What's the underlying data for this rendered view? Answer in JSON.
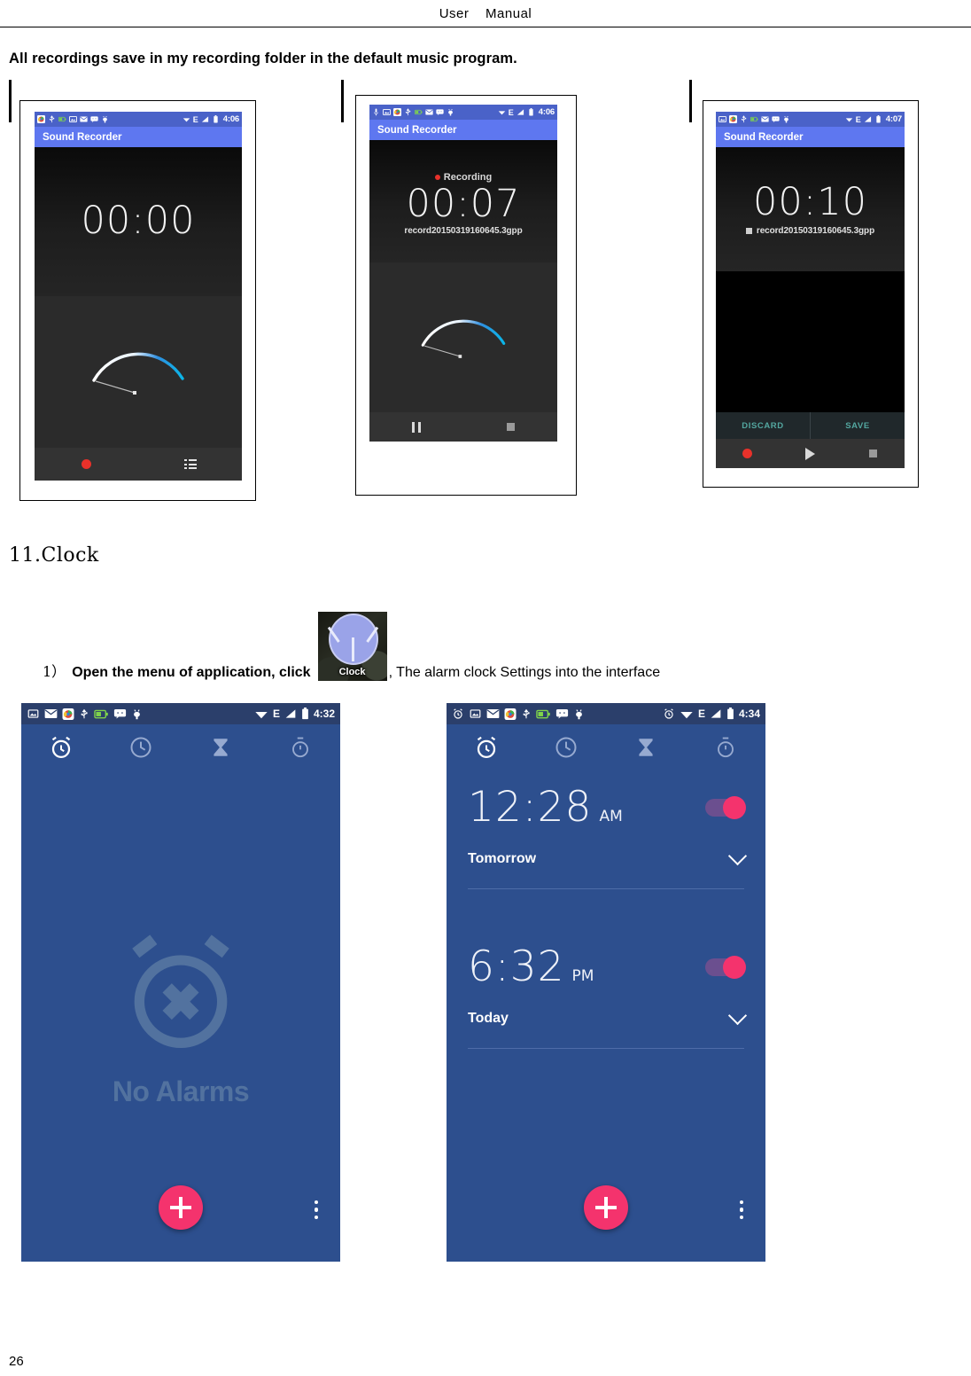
{
  "document": {
    "header_title": "User    Manual",
    "page_number": "26",
    "intro_text": "All recordings save in my recording folder in the default music program.",
    "section_heading": "11.Clock",
    "step": {
      "number": "1）",
      "text_before": "Open the menu of application, click",
      "icon_label": "Clock",
      "text_after": ", The alarm clock Settings into the interface"
    }
  },
  "colors": {
    "status_bar": "#4a62c8",
    "app_bar": "#5e77f0",
    "clock_bg": "#2d4f8e",
    "fab_pink": "#f4336d",
    "record_red": "#e8312a",
    "save_teal": "#53a7a0"
  },
  "recorder_screens": [
    {
      "name": "idle",
      "status_time": "4:06",
      "status_icons": [
        "browser-icon",
        "usb-icon",
        "battery-charging-icon",
        "screenshot-icon",
        "email-icon",
        "sms-icon",
        "adb-icon"
      ],
      "status_right_icons": [
        "wifi-icon",
        "edge-icon",
        "signal-icon",
        "battery-icon"
      ],
      "app_title": "Sound Recorder",
      "recording_label": "",
      "timer": "00:00",
      "file_name": "",
      "controls": [
        "record-button",
        "recordings-list-button"
      ]
    },
    {
      "name": "recording",
      "status_time": "4:06",
      "status_icons": [
        "mic-icon",
        "screenshot-icon",
        "browser-icon",
        "usb-icon",
        "battery-charging-icon",
        "email-icon",
        "sms-icon",
        "adb-icon"
      ],
      "status_right_icons": [
        "wifi-icon",
        "edge-icon",
        "signal-icon",
        "battery-icon"
      ],
      "app_title": "Sound Recorder",
      "recording_label": "Recording",
      "timer": "00:07",
      "file_name": "record20150319160645.3gpp",
      "controls": [
        "pause-button",
        "stop-button"
      ]
    },
    {
      "name": "stopped",
      "status_time": "4:07",
      "status_icons": [
        "screenshot-icon",
        "browser-icon",
        "usb-icon",
        "battery-charging-icon",
        "email-icon",
        "sms-icon",
        "adb-icon"
      ],
      "status_right_icons": [
        "wifi-icon",
        "edge-icon",
        "signal-icon",
        "battery-icon"
      ],
      "app_title": "Sound Recorder",
      "recording_label": "",
      "timer": "00:10",
      "file_name": "record20150319160645.3gpp",
      "discard_label": "DISCARD",
      "save_label": "SAVE",
      "controls": [
        "record-button",
        "play-button",
        "stop-button"
      ]
    }
  ],
  "clock_screens": [
    {
      "name": "no-alarms",
      "status_time": "4:32",
      "tabs": [
        "alarm-tab",
        "clock-tab",
        "timer-tab",
        "stopwatch-tab"
      ],
      "empty_state_text": "No Alarms",
      "fab_label": "+",
      "overflow_label": "more-options"
    },
    {
      "name": "alarms-list",
      "status_time": "4:34",
      "tabs": [
        "alarm-tab",
        "clock-tab",
        "timer-tab",
        "stopwatch-tab"
      ],
      "alarms": [
        {
          "time": "12:28",
          "ampm": "AM",
          "day": "Tomorrow",
          "enabled": true
        },
        {
          "time": "6:32",
          "ampm": "PM",
          "day": "Today",
          "enabled": true
        }
      ],
      "fab_label": "+",
      "overflow_label": "more-options"
    }
  ]
}
